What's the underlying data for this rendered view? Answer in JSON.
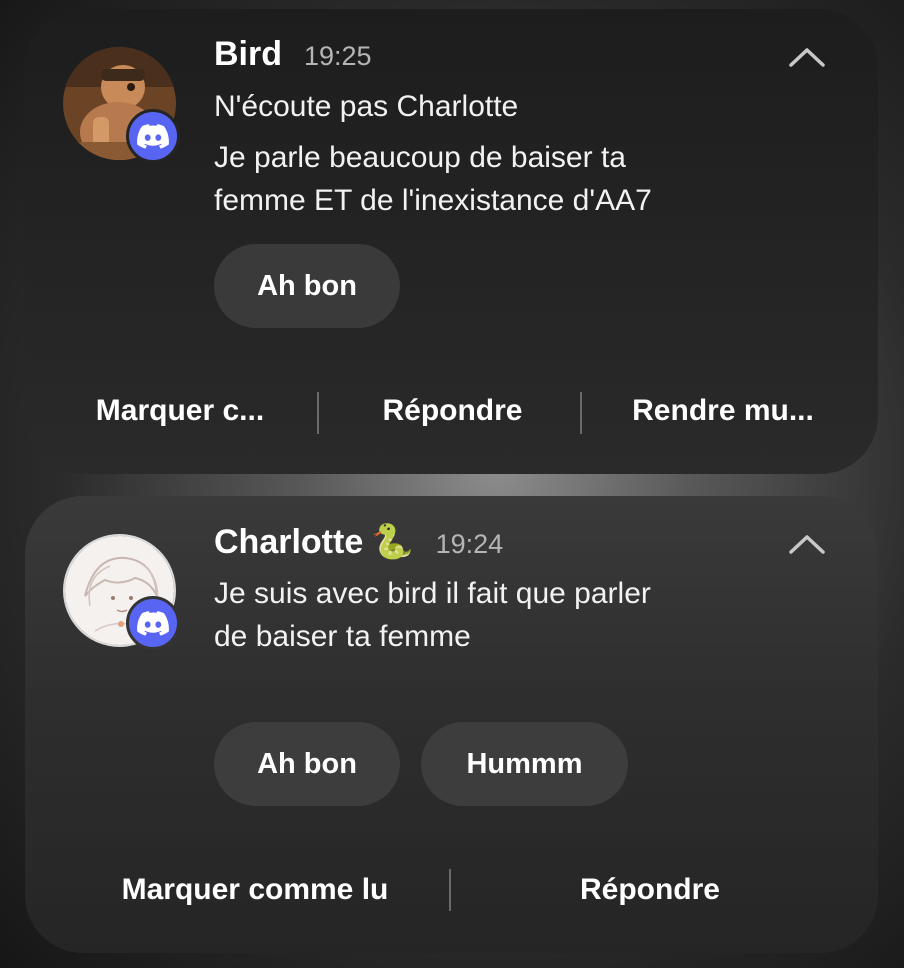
{
  "notifications": [
    {
      "sender": "Bird",
      "time": "19:25",
      "messages": [
        "N'écoute pas Charlotte",
        "Je parle beaucoup de baiser ta",
        "femme ET de l'inexistance d'AA7"
      ],
      "smart_replies": [
        "Ah bon"
      ],
      "actions": [
        "Marquer c...",
        "Répondre",
        "Rendre mu..."
      ],
      "app_icon": "discord-icon",
      "expand_icon": "chevron-up-icon"
    },
    {
      "sender": "Charlotte",
      "sender_emoji": "🐍",
      "time": "19:24",
      "messages": [
        "Je suis avec bird il fait que parler",
        "de baiser ta femme"
      ],
      "smart_replies": [
        "Ah bon",
        "Hummm"
      ],
      "actions": [
        "Marquer comme lu",
        "Répondre"
      ],
      "app_icon": "discord-icon",
      "expand_icon": "chevron-up-icon"
    }
  ],
  "colors": {
    "discord_blurple": "#5865f2",
    "card_background": "#242424",
    "chip_background": "#3a3a3a",
    "secondary_text": "#b5b5b5"
  }
}
